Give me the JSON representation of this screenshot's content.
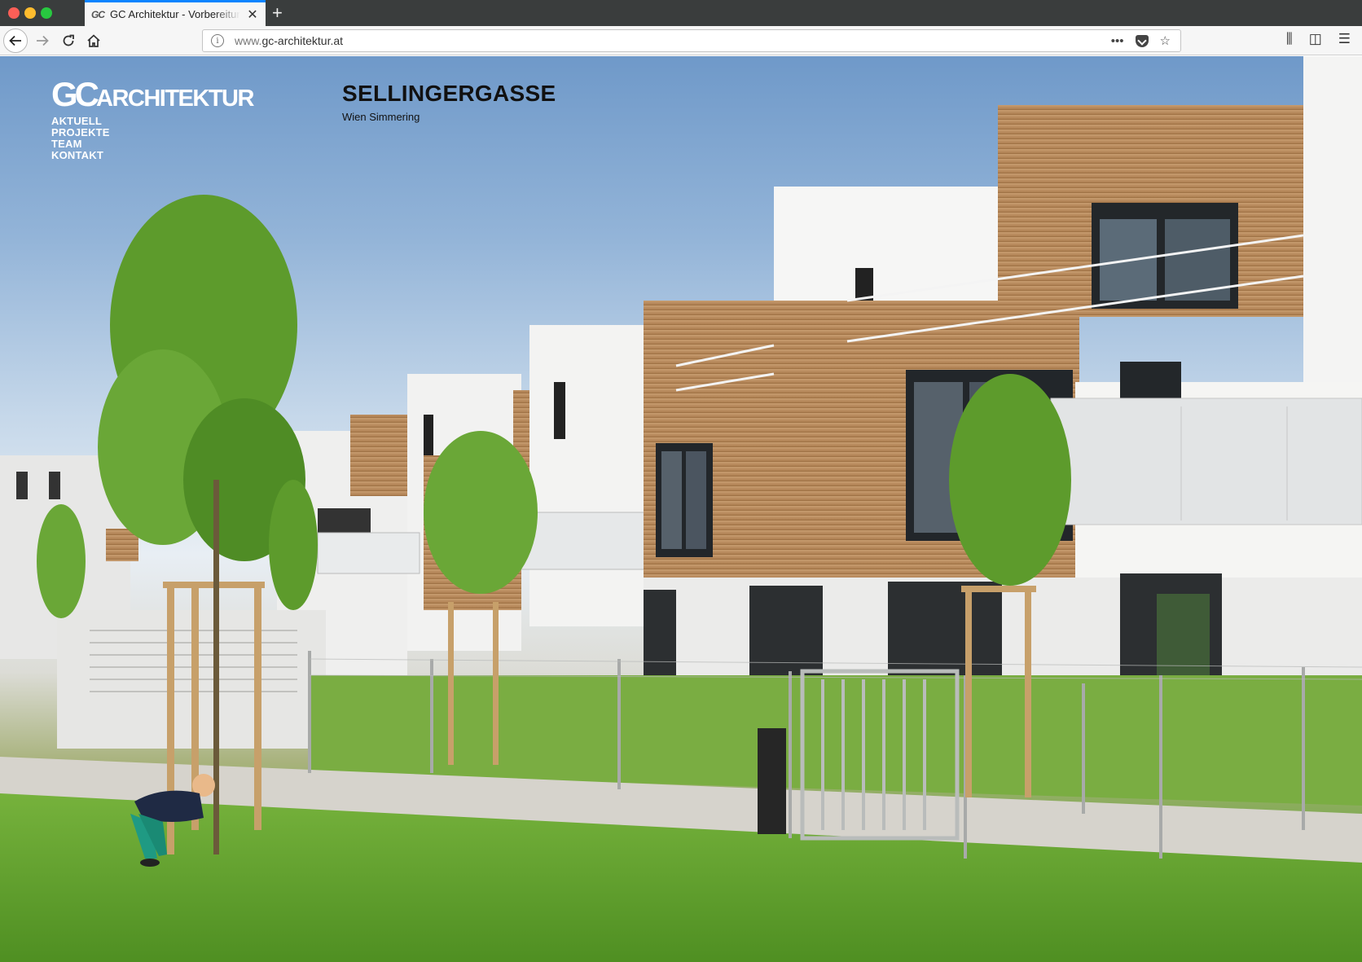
{
  "browser": {
    "tab": {
      "favicon": "GC",
      "title": "GC Architektur - Vorbereitung u"
    },
    "url": {
      "prefix": "www.",
      "domain": "gc-architektur.at"
    }
  },
  "site": {
    "logo": {
      "gc": "GC",
      "rest": "ARCHITEKTUR"
    },
    "nav": [
      "AKTUELL",
      "PROJEKTE",
      "TEAM",
      "KONTAKT"
    ]
  },
  "project": {
    "title": "SELLINGERGASSE",
    "subtitle": "Wien Simmering"
  },
  "colors": {
    "tab_accent": "#0a84ff",
    "sky": "#7aa2cf",
    "wood": "#c79a6c",
    "grass": "#62a22f"
  },
  "icons": [
    "back-arrow-icon",
    "forward-arrow-icon",
    "reload-icon",
    "home-icon",
    "info-icon",
    "more-actions-icon",
    "pocket-icon",
    "bookmark-star-icon",
    "library-icon",
    "sidebar-icon",
    "hamburger-menu-icon",
    "close-icon",
    "plus-icon"
  ]
}
